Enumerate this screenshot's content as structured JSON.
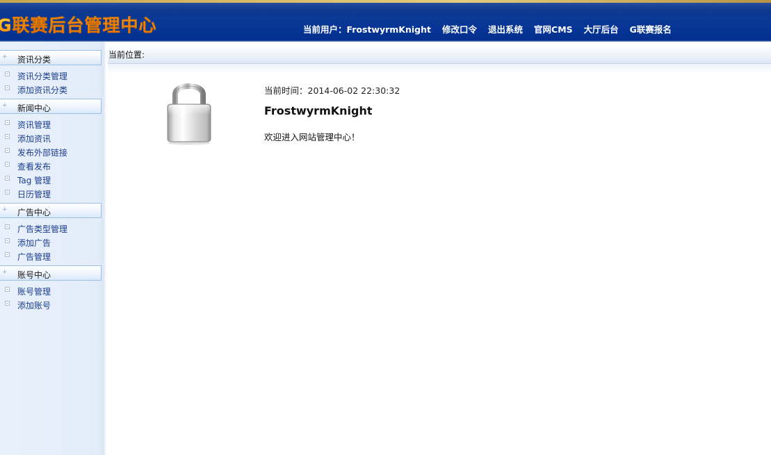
{
  "header": {
    "logo_text": "G联赛后台管理中心",
    "current_user_prefix": "当前用户：",
    "current_user": "FrostwyrmKnight",
    "nav": [
      "修改口令",
      "退出系统",
      "官网CMS",
      "大厅后台",
      "G联赛报名"
    ]
  },
  "sidebar": {
    "sections": [
      {
        "title": "资讯分类",
        "items": [
          "资讯分类管理",
          "添加资讯分类"
        ]
      },
      {
        "title": "新闻中心",
        "items": [
          "资讯管理",
          "添加资讯",
          "发布外部链接",
          "查看发布",
          "Tag 管理",
          "日历管理"
        ]
      },
      {
        "title": "广告中心",
        "items": [
          "广告类型管理",
          "添加广告",
          "广告管理"
        ]
      },
      {
        "title": "账号中心",
        "items": [
          "账号管理",
          "添加账号"
        ]
      }
    ]
  },
  "main": {
    "breadcrumb_label": "当前位置:",
    "time_label": "当前时间：",
    "time_value": "2014-06-02 22:30:32",
    "username": "FrostwyrmKnight",
    "welcome": "欢迎进入网站管理中心！"
  }
}
